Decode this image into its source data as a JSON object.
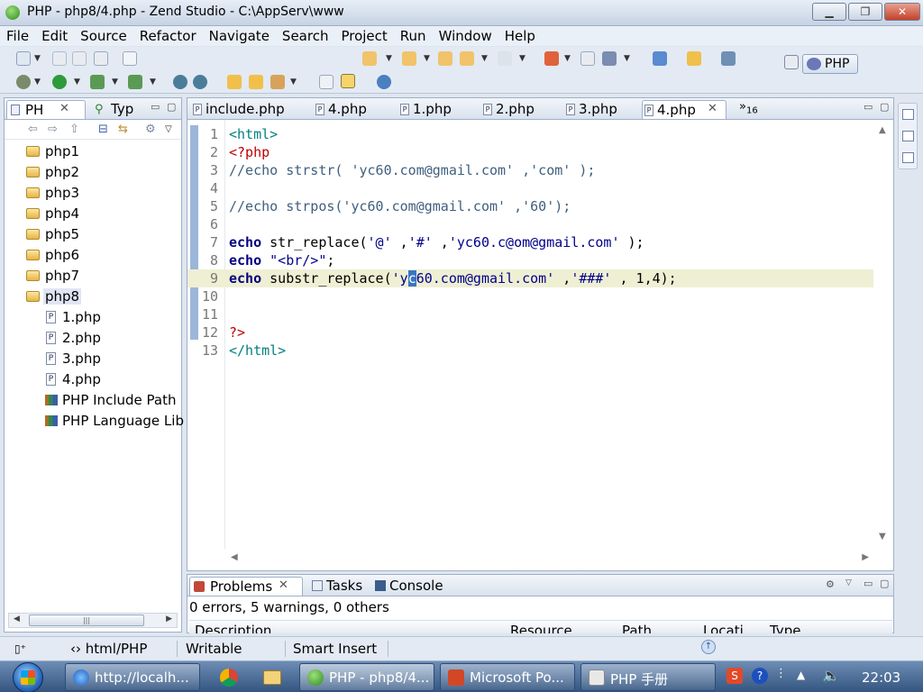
{
  "window": {
    "title": "PHP - php8/4.php - Zend Studio - C:\\AppServ\\www"
  },
  "menu": [
    "File",
    "Edit",
    "Source",
    "Refactor",
    "Navigate",
    "Search",
    "Project",
    "Run",
    "Window",
    "Help"
  ],
  "perspective": {
    "label": "PHP"
  },
  "left_panel": {
    "tabs": [
      {
        "label": "PH",
        "close": "✕"
      },
      {
        "label": "Typ"
      }
    ],
    "projects": [
      "php1",
      "php2",
      "php3",
      "php4",
      "php5",
      "php6",
      "php7",
      "php8"
    ],
    "php8_children": [
      {
        "type": "file",
        "label": "1.php"
      },
      {
        "type": "file",
        "label": "2.php"
      },
      {
        "type": "file",
        "label": "3.php"
      },
      {
        "type": "file",
        "label": "4.php"
      },
      {
        "type": "lib",
        "label": "PHP Include Path"
      },
      {
        "type": "lib",
        "label": "PHP Language Lib"
      }
    ]
  },
  "editor": {
    "tabs": [
      "include.php",
      "4.php",
      "1.php",
      "2.php",
      "3.php",
      "4.php"
    ],
    "active_tab_close": "✕",
    "overflow": "»",
    "overflow_count": "16",
    "lines": [
      {
        "n": "1",
        "parts": [
          {
            "cls": "c-tag",
            "t": "<html>"
          }
        ]
      },
      {
        "n": "2",
        "parts": [
          {
            "cls": "c-php",
            "t": "<?php"
          }
        ]
      },
      {
        "n": "3",
        "parts": [
          {
            "cls": "c-comment",
            "t": "//echo strstr( 'yc60.com@gmail.com' ,'com' );"
          }
        ]
      },
      {
        "n": "4",
        "parts": []
      },
      {
        "n": "5",
        "parts": [
          {
            "cls": "c-comment",
            "t": "//echo strpos('yc60.com@gmail.com' ,'60');"
          }
        ]
      },
      {
        "n": "6",
        "parts": []
      },
      {
        "n": "7",
        "parts": [
          {
            "cls": "c-kw",
            "t": "echo"
          },
          {
            "cls": "c-fn",
            "t": " str_replace("
          },
          {
            "cls": "c-str",
            "t": "'@'"
          },
          {
            "cls": "c-fn",
            "t": " ,"
          },
          {
            "cls": "c-str",
            "t": "'#'"
          },
          {
            "cls": "c-fn",
            "t": " ,"
          },
          {
            "cls": "c-str",
            "t": "'yc60.c@om@gmail.com'"
          },
          {
            "cls": "c-fn",
            "t": " );"
          }
        ]
      },
      {
        "n": "8",
        "parts": [
          {
            "cls": "c-kw",
            "t": "echo"
          },
          {
            "cls": "c-fn",
            "t": " "
          },
          {
            "cls": "c-str",
            "t": "\"<br/>\""
          },
          {
            "cls": "c-fn",
            "t": ";"
          }
        ]
      },
      {
        "n": "9",
        "parts": [
          {
            "cls": "c-kw",
            "t": "echo"
          },
          {
            "cls": "c-fn",
            "t": " substr_replace("
          },
          {
            "cls": "c-str",
            "t": "'y"
          },
          {
            "cls": "sel",
            "t": "c"
          },
          {
            "cls": "c-str",
            "t": "60.com@gmail.com'"
          },
          {
            "cls": "c-fn",
            "t": " ,"
          },
          {
            "cls": "c-str",
            "t": "'###'"
          },
          {
            "cls": "c-fn",
            "t": " , 1,4);"
          }
        ]
      },
      {
        "n": "10",
        "parts": []
      },
      {
        "n": "11",
        "parts": []
      },
      {
        "n": "12",
        "parts": [
          {
            "cls": "c-php",
            "t": "?>"
          }
        ]
      },
      {
        "n": "13",
        "parts": [
          {
            "cls": "c-tag",
            "t": "</html>"
          }
        ]
      }
    ],
    "current_line": "9"
  },
  "bottom_panel": {
    "tabs": [
      "Problems",
      "Tasks",
      "Console"
    ],
    "active_close": "✕",
    "summary": "0 errors, 5 warnings, 0 others",
    "columns": [
      "Description",
      "Resource",
      "Path",
      "Locati",
      "Type"
    ]
  },
  "status": {
    "mode": "html/PHP",
    "writable": "Writable",
    "insert": "Smart Insert"
  },
  "taskbar": {
    "tasks": [
      "http://localh...",
      "PHP - php8/4...",
      "Microsoft Po...",
      "PHP 手册"
    ],
    "time": "22:03"
  }
}
